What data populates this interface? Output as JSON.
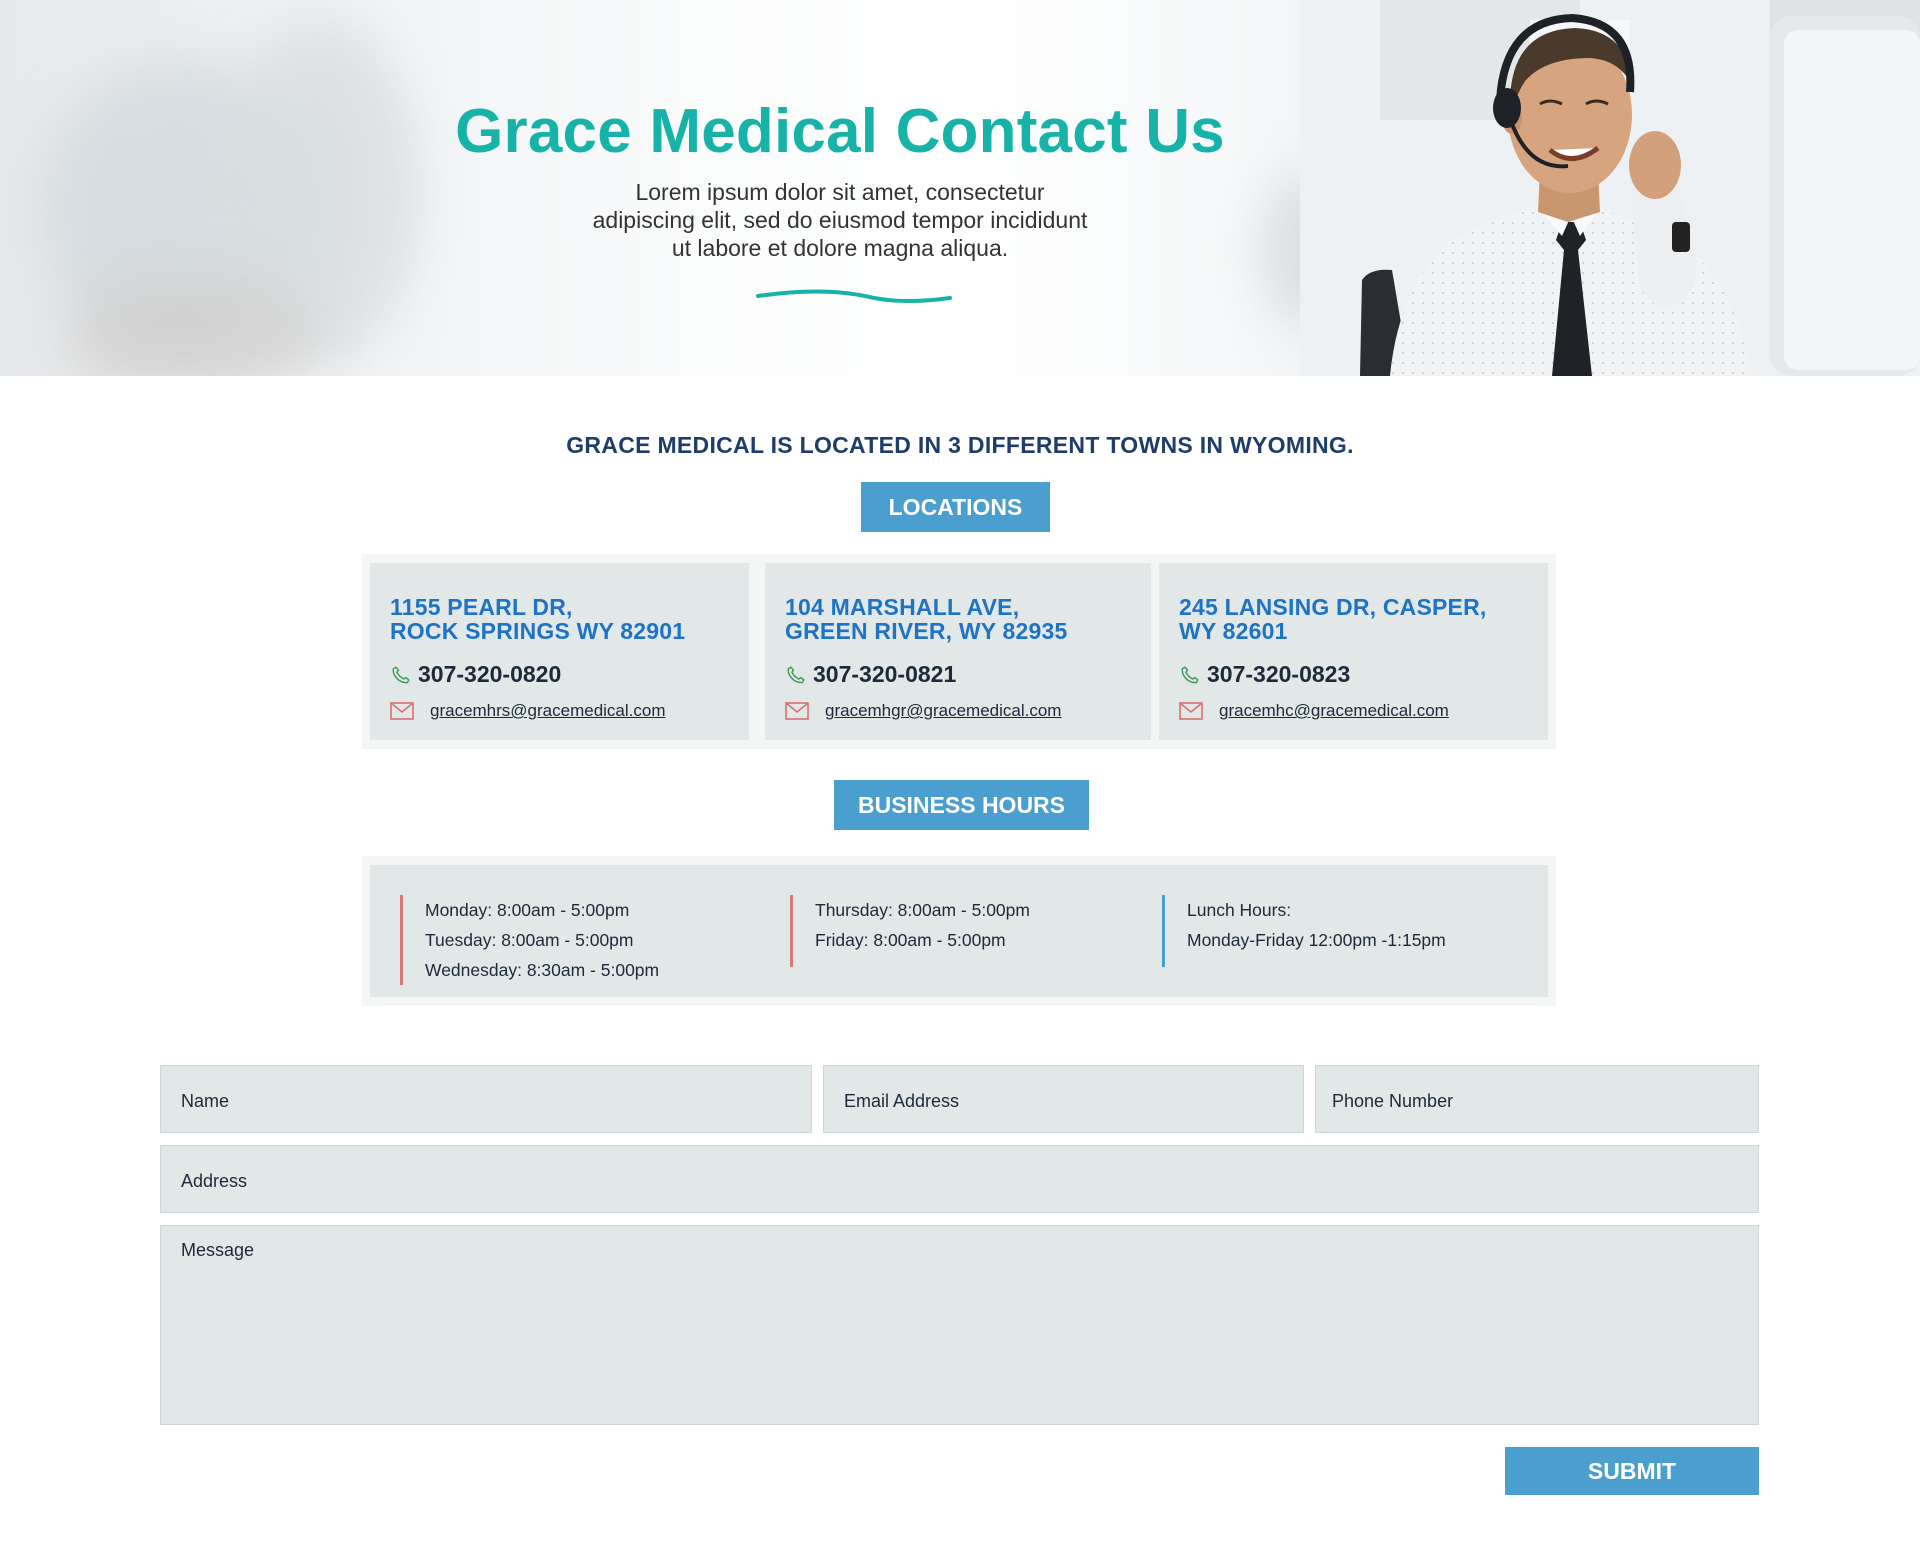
{
  "hero": {
    "title": "Grace Medical Contact Us",
    "subtitle_lines": [
      "Lorem ipsum dolor sit amet, consectetur",
      "adipiscing elit, sed do eiusmod tempor incididunt",
      "ut labore et dolore magna aliqua."
    ],
    "accent_color": "#17b3a8"
  },
  "intro": "GRACE MEDICAL IS LOCATED IN 3 DIFFERENT TOWNS IN WYOMING.",
  "locations_label": "LOCATIONS",
  "locations": [
    {
      "address_lines": [
        "1155 PEARL DR,",
        "ROCK SPRINGS WY 82901"
      ],
      "phone": "307-320-0820",
      "email": "gracemhrs@gracemedical.com"
    },
    {
      "address_lines": [
        "104 MARSHALL AVE,",
        "GREEN RIVER, WY 82935"
      ],
      "phone": "307-320-0821",
      "email": "gracemhgr@gracemedical.com"
    },
    {
      "address_lines": [
        "245 LANSING DR, CASPER,",
        "WY 82601"
      ],
      "phone": "307-320-0823",
      "email": "gracemhc@gracemedical.com"
    }
  ],
  "hours_label": "BUSINESS HOURS",
  "hours": {
    "col1": [
      "Monday: 8:00am - 5:00pm",
      "Tuesday: 8:00am - 5:00pm",
      "Wednesday: 8:30am - 5:00pm"
    ],
    "col2": [
      "Thursday: 8:00am - 5:00pm",
      "Friday: 8:00am - 5:00pm"
    ],
    "col3": [
      "Lunch Hours:",
      "Monday-Friday 12:00pm -1:15pm"
    ]
  },
  "form": {
    "name_placeholder": "Name",
    "email_placeholder": "Email Address",
    "phone_placeholder": "Phone Number",
    "address_placeholder": "Address",
    "message_placeholder": "Message",
    "submit_label": "SUBMIT"
  },
  "icons": {
    "phone": "phone-icon",
    "email": "mail-icon"
  },
  "colors": {
    "heading_navy": "#1f3d6a",
    "address_blue": "#1f73c4",
    "button_blue": "#4a9fce",
    "hours_red_bar": "#d87a7a",
    "field_bg": "#e2e7e8"
  }
}
